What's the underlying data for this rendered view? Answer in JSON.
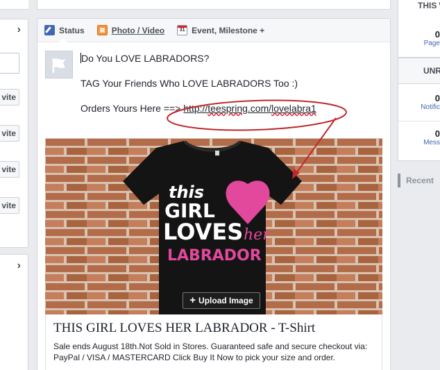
{
  "left_panel": {
    "invite_label": "vite",
    "invite_count": 4
  },
  "composer": {
    "tabs": [
      {
        "label": "Status",
        "icon": "pencil-icon"
      },
      {
        "label": "Photo / Video",
        "icon": "photo-icon"
      },
      {
        "label": "Event, Milestone +",
        "icon": "calendar-icon",
        "icon_text": "31"
      }
    ],
    "post_lines": {
      "line1": "Do You LOVE LABRADORS?",
      "line2": "TAG Your Friends Who LOVE LABRADORS Too :)",
      "line3_prefix": "Orders Yours Here ==> ",
      "line3_link_a": "http://",
      "line3_link_b": "teespring",
      "line3_link_c": ".com/",
      "line3_link_d": "lovelabra1"
    },
    "shirt_graphic": {
      "word1": "this",
      "word2": "GIRL",
      "word3": "LOVES",
      "word4": "her",
      "word5": "LABRADOR",
      "shirt_color": "#141414",
      "heart_color": "#e2489c",
      "brick_color": "#b7714f"
    },
    "upload_button": {
      "plus": "+",
      "label": "Upload Image"
    },
    "link_card": {
      "title": "THIS GIRL LOVES HER LABRADOR - T-Shirt",
      "description": "Sale ends August 18th.Not Sold in Stores.   Guaranteed safe and secure checkout via: PayPal / VISA / MASTERCARD   Click Buy It Now to pick your size and order."
    },
    "annotation_color": "#c0282d"
  },
  "right_panel": {
    "header1": "THIS W",
    "item1_num": "0",
    "item1_label": "Page",
    "header2": "UNR",
    "item2_num": "0",
    "item2_label": "Notific",
    "item3_num": "0",
    "item3_label": "Mess",
    "recent_label": "Recent"
  }
}
